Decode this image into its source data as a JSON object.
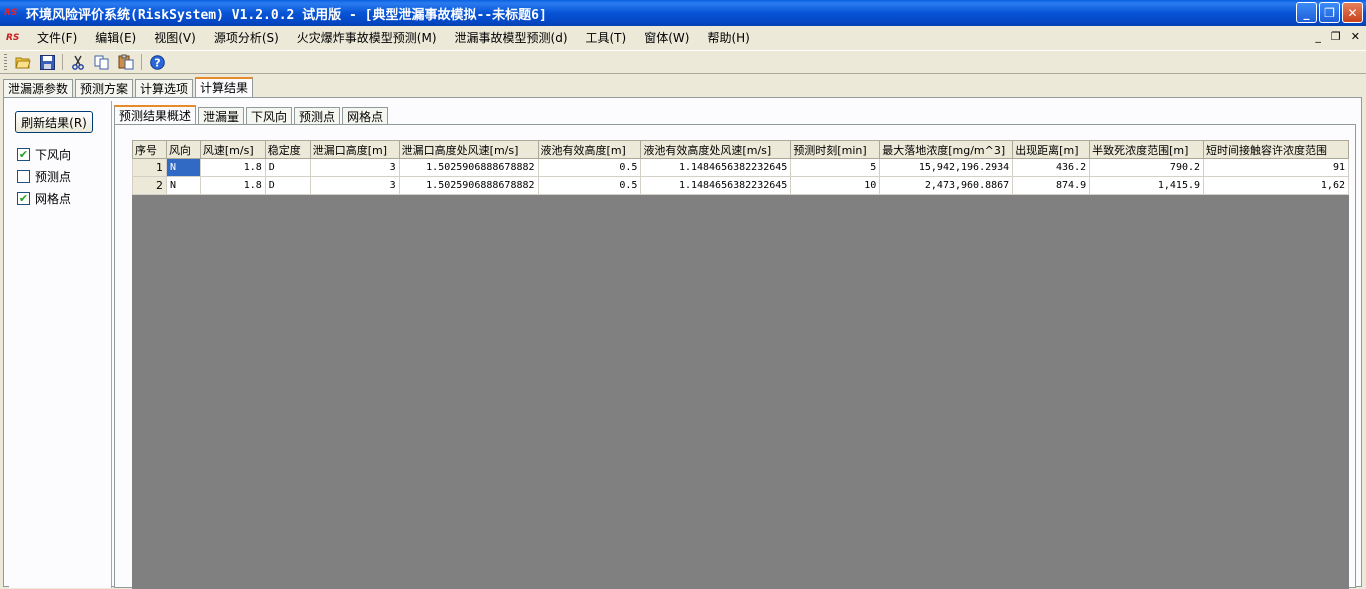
{
  "window": {
    "logo": "RS",
    "title": "环境风险评价系统(RiskSystem) V1.2.0.2 试用版 - [典型泄漏事故模拟--未标题6]",
    "minimize": "_",
    "restore": "❐",
    "close": "✕"
  },
  "menu": {
    "items": [
      "文件(F)",
      "编辑(E)",
      "视图(V)",
      "源项分析(S)",
      "火灾爆炸事故模型预测(M)",
      "泄漏事故模型预测(d)",
      "工具(T)",
      "窗体(W)",
      "帮助(H)"
    ],
    "mdi_min": "_",
    "mdi_restore": "❐",
    "mdi_close": "✕"
  },
  "toolbar": {
    "icons": [
      "open-folder-icon",
      "save-icon",
      "cut-icon",
      "copy-icon",
      "paste-icon",
      "help-icon"
    ]
  },
  "outer_tabs": [
    "泄漏源参数",
    "预测方案",
    "计算选项",
    "计算结果"
  ],
  "left": {
    "refresh_label": "刷新结果(R)",
    "checks": [
      {
        "label": "下风向",
        "checked": true
      },
      {
        "label": "预测点",
        "checked": false
      },
      {
        "label": "网格点",
        "checked": true
      }
    ]
  },
  "inner_tabs": [
    "预测结果概述",
    "泄漏量",
    "下风向",
    "预测点",
    "网格点"
  ],
  "grid": {
    "columns": [
      "序号",
      "风向",
      "风速[m/s]",
      "稳定度",
      "泄漏口高度[m]",
      "泄漏口高度处风速[m/s]",
      "液池有效高度[m]",
      "液池有效高度处风速[m/s]",
      "预测时刻[min]",
      "最大落地浓度[mg/m^3]",
      "出现距离[m]",
      "半致死浓度范围[m]",
      "短时间接触容许浓度范围"
    ],
    "rows": [
      [
        "1",
        "N",
        "1.8",
        "D",
        "3",
        "1.5025906888678882",
        "0.5",
        "1.1484656382232645",
        "5",
        "15,942,196.2934",
        "436.2",
        "790.2",
        "91"
      ],
      [
        "2",
        "N",
        "1.8",
        "D",
        "3",
        "1.5025906888678882",
        "0.5",
        "1.1484656382232645",
        "10",
        "2,473,960.8867",
        "874.9",
        "1,415.9",
        "1,62"
      ]
    ]
  },
  "colors": {
    "titlebar": "#0654d6",
    "grid_background": "#808080",
    "active_tab_accent": "#e68b2c",
    "selected_cell": "#316ac5"
  }
}
